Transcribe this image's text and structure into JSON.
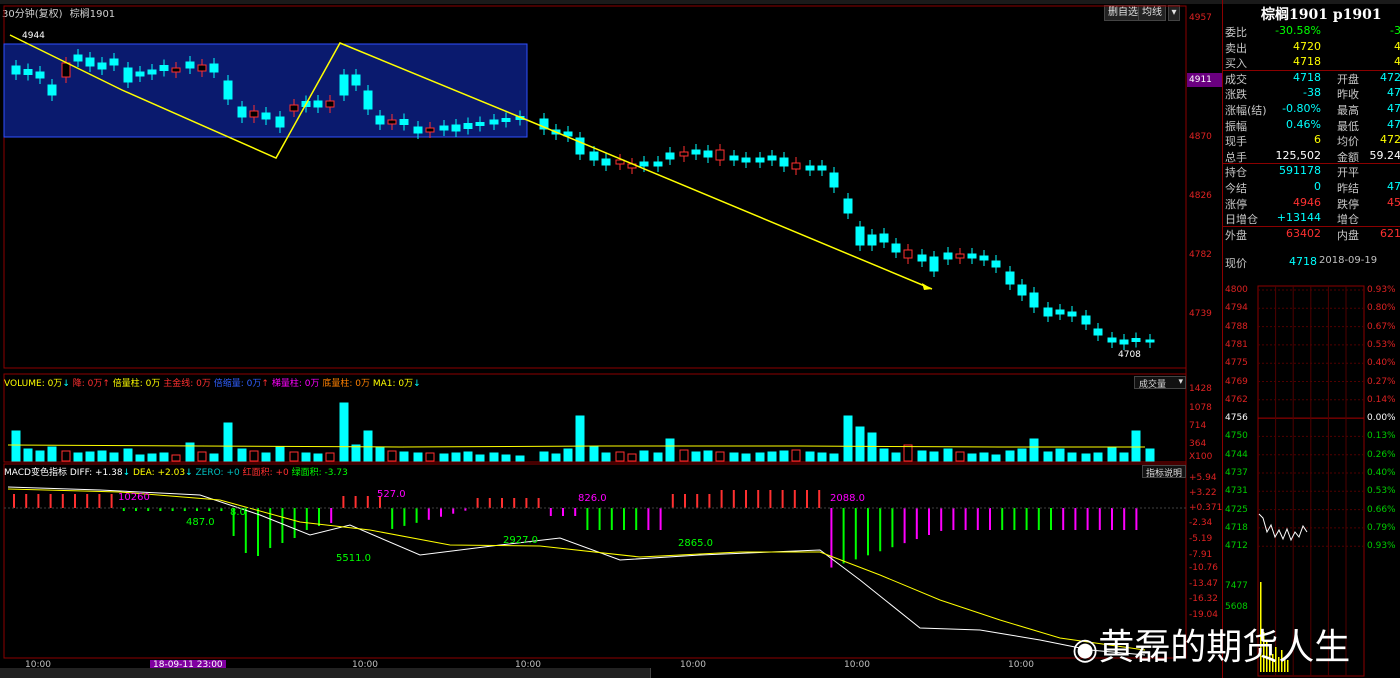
{
  "header": {
    "period": "30分钟(复权)",
    "symbol_name": "棕榈1901",
    "btn_reset": "删自选",
    "btn_avg": "均线"
  },
  "price_axis": [
    "4957",
    "4911",
    "4870",
    "4826",
    "4782",
    "4739"
  ],
  "annotations": {
    "high": "4944",
    "low": "4708"
  },
  "volume": {
    "legend": {
      "vol": "VOLUME: 0万",
      "down": "降: 0万",
      "dbl": "倍量柱: 0万",
      "gold": "主金线: 0万",
      "neg": "倍缩量: 0万",
      "ladder": "梯量柱: 0万",
      "low": "底量柱: 0万",
      "ma1": "MA1: 0万"
    },
    "selector": "成交量",
    "axis": [
      "1428",
      "1078",
      "714",
      "364",
      "X100"
    ]
  },
  "macd": {
    "legend": {
      "name": "MACD变色指标",
      "diff": "DIFF: +1.38",
      "dea": "DEA: +2.03",
      "zero": "ZERO: +0",
      "red": "红面积: +0",
      "green": "绿面积: -3.73"
    },
    "help_btn": "指标说明",
    "axis": [
      "+5.94",
      "+3.22",
      "+0.371",
      "-2.34",
      "-5.19",
      "-7.91",
      "-10.76",
      "-13.47",
      "-16.32",
      "-19.04"
    ],
    "labels": [
      {
        "text": "10260",
        "color": "#ff00ff"
      },
      {
        "text": "487.0",
        "color": "#00ff00"
      },
      {
        "text": "8.0",
        "color": "#00ff00"
      },
      {
        "text": "527.0",
        "color": "#ff00ff"
      },
      {
        "text": "5511.0",
        "color": "#00ff00"
      },
      {
        "text": "2927.0",
        "color": "#00ff00"
      },
      {
        "text": "826.0",
        "color": "#ff00ff"
      },
      {
        "text": "2865.0",
        "color": "#00ff00"
      },
      {
        "text": "2088.0",
        "color": "#ff00ff"
      }
    ]
  },
  "time_axis": [
    "10:00",
    "18-09-11 23:00",
    "10:00",
    "10:00",
    "10:00",
    "10:00",
    "10:00"
  ],
  "quote": {
    "title": "棕榈1901 p1901",
    "rows": [
      {
        "l": "委比",
        "v": "-30.58%",
        "vc": "#00ff00",
        "l2": "",
        "v2": "-3"
      },
      {
        "l": "卖出",
        "v": "4720",
        "vc": "#ffff00",
        "l2": "",
        "v2": "4"
      },
      {
        "l": "买入",
        "v": "4718",
        "vc": "#ffff00",
        "l2": "",
        "v2": "4"
      },
      {
        "l": "成交",
        "v": "4718",
        "vc": "#00ffff",
        "l2": "开盘",
        "v2": "472"
      },
      {
        "l": "涨跌",
        "v": "-38",
        "vc": "#00ffff",
        "l2": "昨收",
        "v2": "47"
      },
      {
        "l": "涨幅(结)",
        "v": "-0.80%",
        "vc": "#00ffff",
        "l2": "最高",
        "v2": "47"
      },
      {
        "l": "振幅",
        "v": "0.46%",
        "vc": "#00ffff",
        "l2": "最低",
        "v2": "47"
      },
      {
        "l": "现手",
        "v": "6",
        "vc": "#ffff00",
        "l2": "均价",
        "v2": "472"
      },
      {
        "l": "总手",
        "v": "125,502",
        "vc": "#ffffff",
        "l2": "金额",
        "v2": "59.24"
      },
      {
        "l": "持仓",
        "v": "591178",
        "vc": "#00ffff",
        "l2": "开平",
        "v2": ""
      },
      {
        "l": "今结",
        "v": "0",
        "vc": "#00ffff",
        "l2": "昨结",
        "v2": "47"
      },
      {
        "l": "涨停",
        "v": "4946",
        "vc": "#ff3030",
        "l2": "跌停",
        "v2": "45"
      },
      {
        "l": "日增仓",
        "v": "+13144",
        "vc": "#00ffff",
        "l2": "增仓",
        "v2": ""
      },
      {
        "l": "外盘",
        "v": "63402",
        "vc": "#ff3030",
        "l2": "内盘",
        "v2": "621"
      }
    ],
    "now_label": "现价",
    "now_value": "4718",
    "date": "2018-09-19",
    "mini_axis_left": [
      "4800",
      "4794",
      "4788",
      "4781",
      "4775",
      "4769",
      "4762",
      "4756",
      "4750",
      "4744",
      "4737",
      "4731",
      "4725",
      "4718",
      "4712",
      "7477",
      "5608"
    ],
    "mini_axis_right": [
      "0.93%",
      "0.80%",
      "0.67%",
      "0.53%",
      "0.40%",
      "0.27%",
      "0.14%",
      "0.00%",
      "0.13%",
      "0.26%",
      "0.40%",
      "0.53%",
      "0.66%",
      "0.79%",
      "0.93%"
    ]
  },
  "watermark": "黄磊的期货人生"
}
